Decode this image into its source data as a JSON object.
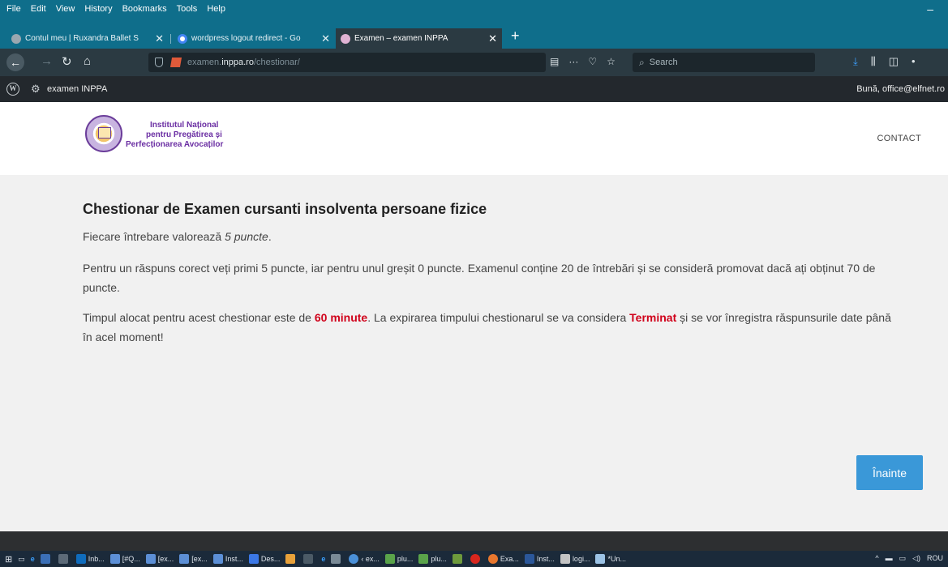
{
  "menu": [
    "File",
    "Edit",
    "View",
    "History",
    "Bookmarks",
    "Tools",
    "Help"
  ],
  "tabs": [
    {
      "label": "Contul meu | Ruxandra Ballet S",
      "favicon_color": "#9aa7b0"
    },
    {
      "label": "wordpress logout redirect - Go",
      "favicon_color": "#ffffff"
    },
    {
      "label": "Examen – examen INPPA",
      "favicon_color": "#e0b3d4"
    }
  ],
  "urlbar": {
    "prefix": "examen.",
    "domain": "inppa.ro",
    "path": "/chestionar/"
  },
  "search": {
    "placeholder": "Search"
  },
  "wp_admin": {
    "site_name": "examen INPPA",
    "greeting": "Bună, office@elfnet.ro"
  },
  "header": {
    "logo_lines": [
      "Institutul Național",
      "pentru Pregătirea și",
      "Perfecționarea Avocaților"
    ],
    "contact": "CONTACT"
  },
  "quiz": {
    "title": "Chestionar de Examen cursanti insolventa persoane fizice",
    "intro_prefix": "Fiecare întrebare valorează ",
    "intro_points": "5 puncte",
    "intro_suffix": ".",
    "rules": "Pentru un răspuns corect veți primi 5 puncte, iar pentru unul greșit 0 puncte. Examenul conține 20 de întrebări și se consideră promovat dacă ați obținut 70 de puncte.",
    "time_prefix": "Timpul alocat pentru acest chestionar este de ",
    "time_value": "60 minute",
    "time_mid": ". La expirarea timpului chestionarul se va considera ",
    "time_status": "Terminat",
    "time_suffix": " și se vor înregistra răspunsurile date până în acel moment!",
    "next_button": "Înainte"
  },
  "taskbar": {
    "items": [
      {
        "label": "Inb...",
        "color": "#0f6cbd"
      },
      {
        "label": "[#Q...",
        "color": "#5c8fd6"
      },
      {
        "label": "[ex...",
        "color": "#5c8fd6"
      },
      {
        "label": "[ex...",
        "color": "#5c8fd6"
      },
      {
        "label": "Inst...",
        "color": "#5c8fd6"
      },
      {
        "label": "Des...",
        "color": "#3b78e7"
      },
      {
        "label": "‹ ex...",
        "color": "#4a90d9"
      },
      {
        "label": "plu...",
        "color": "#5aa34a"
      },
      {
        "label": "plu...",
        "color": "#5aa34a"
      },
      {
        "label": "Exa...",
        "color": "#e8772e"
      },
      {
        "label": "Inst...",
        "color": "#2b579a"
      },
      {
        "label": "logi...",
        "color": "#c4c4c4"
      },
      {
        "label": "*Un...",
        "color": "#9cc3e6"
      }
    ],
    "lang": "ROU"
  }
}
